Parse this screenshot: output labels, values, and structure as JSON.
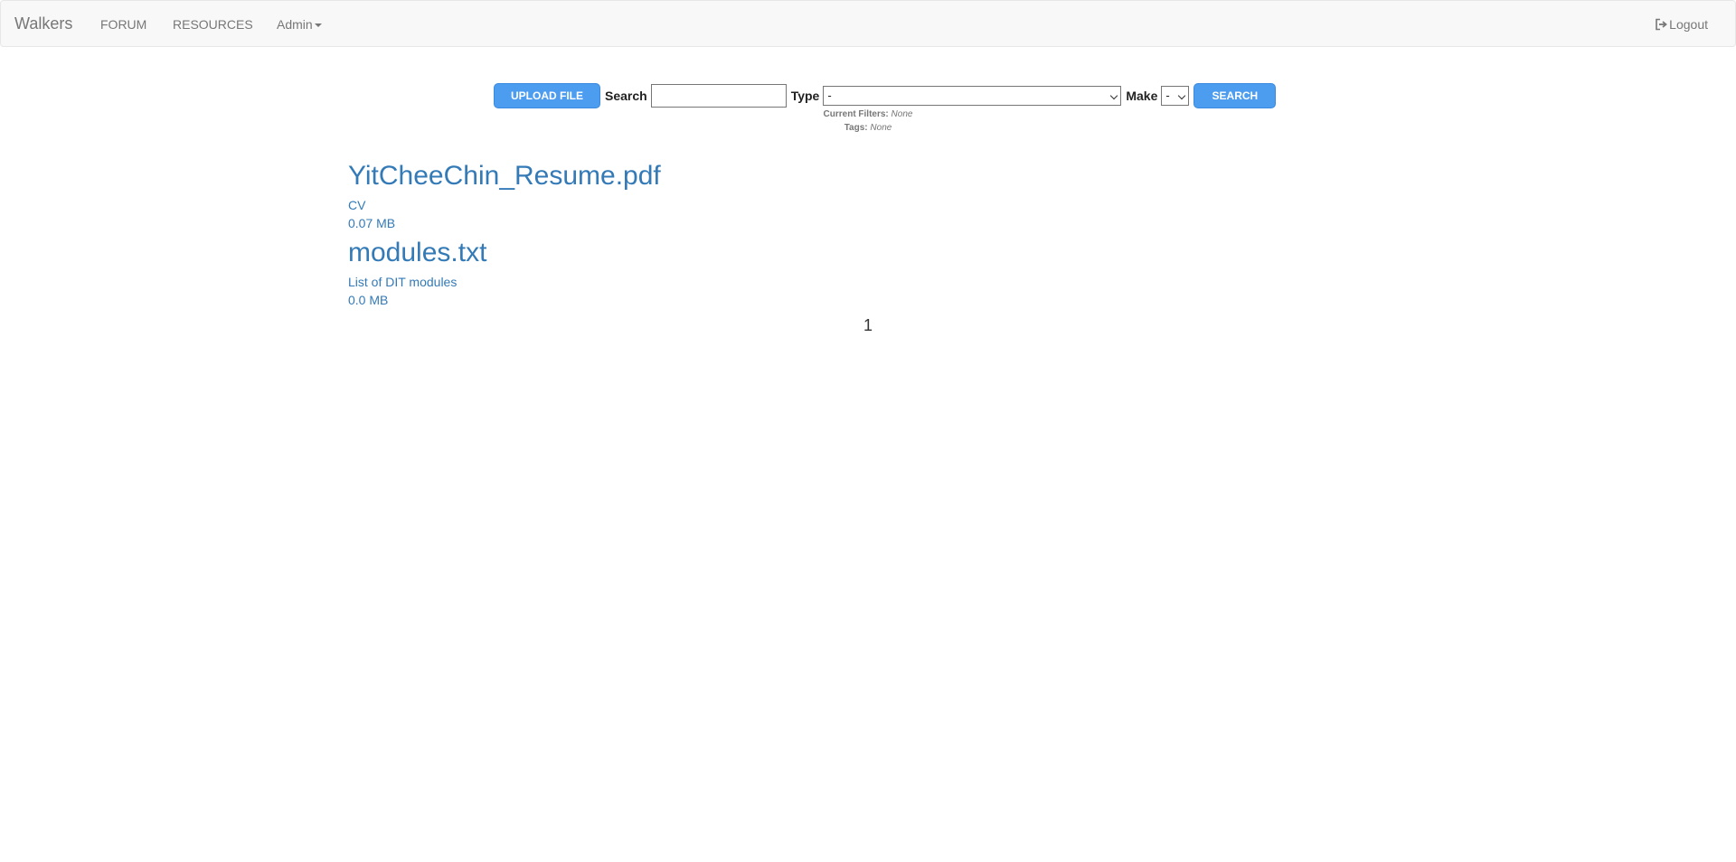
{
  "navbar": {
    "brand": "Walkers",
    "links": [
      {
        "label": "FORUM"
      },
      {
        "label": "RESOURCES"
      }
    ],
    "admin_label": "Admin",
    "logout_label": "Logout"
  },
  "toolbar": {
    "upload_label": "UPLOAD FILE",
    "search_label": "Search",
    "search_value": "",
    "type_label": "Type",
    "type_selected": "-",
    "make_label": "Make",
    "make_selected": "-",
    "search_button_label": "SEARCH"
  },
  "filters": {
    "current_label": "Current Filters:",
    "current_value": "None",
    "tags_label": "Tags:",
    "tags_value": "None"
  },
  "files": [
    {
      "name": "YitCheeChin_Resume.pdf",
      "description": "CV",
      "size": "0.07 MB"
    },
    {
      "name": "modules.txt",
      "description": "List of DIT modules",
      "size": "0.0 MB"
    }
  ],
  "pagination": {
    "current_page": "1"
  }
}
